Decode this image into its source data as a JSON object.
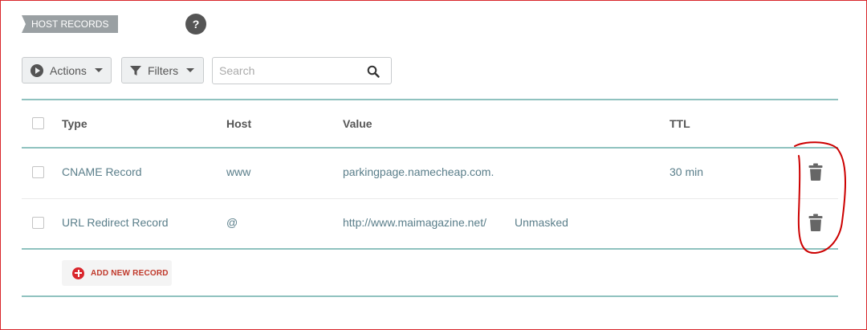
{
  "header": {
    "section_title": "HOST RECORDS",
    "help_icon_label": "?"
  },
  "toolbar": {
    "actions_label": "Actions",
    "filters_label": "Filters",
    "search_placeholder": "Search"
  },
  "table": {
    "columns": [
      "Type",
      "Host",
      "Value",
      "TTL"
    ],
    "rows": [
      {
        "type": "CNAME Record",
        "host": "www",
        "value": "parkingpage.namecheap.com.",
        "extra": "",
        "ttl": "30 min"
      },
      {
        "type": "URL Redirect Record",
        "host": "@",
        "value": "http://www.maimagazine.net/",
        "extra": "Unmasked",
        "ttl": ""
      }
    ]
  },
  "footer": {
    "add_label": "ADD NEW RECORD"
  },
  "icons": {
    "help": "question-circle-icon",
    "actions": "play-circle-icon",
    "filters": "funnel-icon",
    "search": "magnifier-icon",
    "delete": "trash-icon",
    "add": "plus-circle-icon"
  },
  "colors": {
    "accent_line": "#8fc2bf",
    "link_text": "#5a7e8a",
    "add_red": "#d9262c",
    "annotation_red": "#cc0000"
  }
}
